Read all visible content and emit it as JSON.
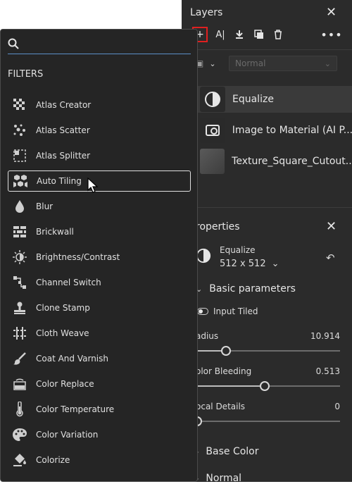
{
  "layers": {
    "title": "Layers",
    "close_icon": "close-icon",
    "blend_mode": "Normal",
    "items": [
      {
        "name": "Equalize",
        "selected": true
      },
      {
        "name": "Image to Material (AI P..."
      },
      {
        "name": "Texture_Square_Cutout..."
      }
    ]
  },
  "properties": {
    "title": "roperties",
    "filter_name": "Equalize",
    "resolution": "512 x 512",
    "section_basic": "Basic parameters",
    "input_tiled_label": "Input Tiled",
    "params": [
      {
        "label": "adius",
        "value": "10.914",
        "fraction": 0.2
      },
      {
        "label": "olor Bleeding",
        "value": "0.513",
        "fraction": 0.47
      },
      {
        "label": "ocal Details",
        "value": "0",
        "fraction": 0.0
      }
    ],
    "section_base_color": "Base Color",
    "section_normal": "Normal"
  },
  "filters": {
    "search_placeholder": "",
    "heading": "FILTERS",
    "items": [
      {
        "label": "Atlas Creator",
        "icon": "checkerboard-icon"
      },
      {
        "label": "Atlas Scatter",
        "icon": "scatter-dots-icon"
      },
      {
        "label": "Atlas Splitter",
        "icon": "splitter-icon"
      },
      {
        "label": "Auto Tiling",
        "icon": "hex-tiles-icon",
        "selected": true
      },
      {
        "label": "Blur",
        "icon": "drop-icon"
      },
      {
        "label": "Brickwall",
        "icon": "brick-icon"
      },
      {
        "label": "Brightness/Contrast",
        "icon": "sun-icon"
      },
      {
        "label": "Channel Switch",
        "icon": "channel-switch-icon"
      },
      {
        "label": "Clone Stamp",
        "icon": "stamp-icon"
      },
      {
        "label": "Cloth Weave",
        "icon": "weave-icon"
      },
      {
        "label": "Coat And Varnish",
        "icon": "brush-icon"
      },
      {
        "label": "Color Replace",
        "icon": "color-replace-icon"
      },
      {
        "label": "Color Temperature",
        "icon": "thermometer-icon"
      },
      {
        "label": "Color Variation",
        "icon": "palette-icon"
      },
      {
        "label": "Colorize",
        "icon": "paint-bucket-icon"
      }
    ]
  }
}
